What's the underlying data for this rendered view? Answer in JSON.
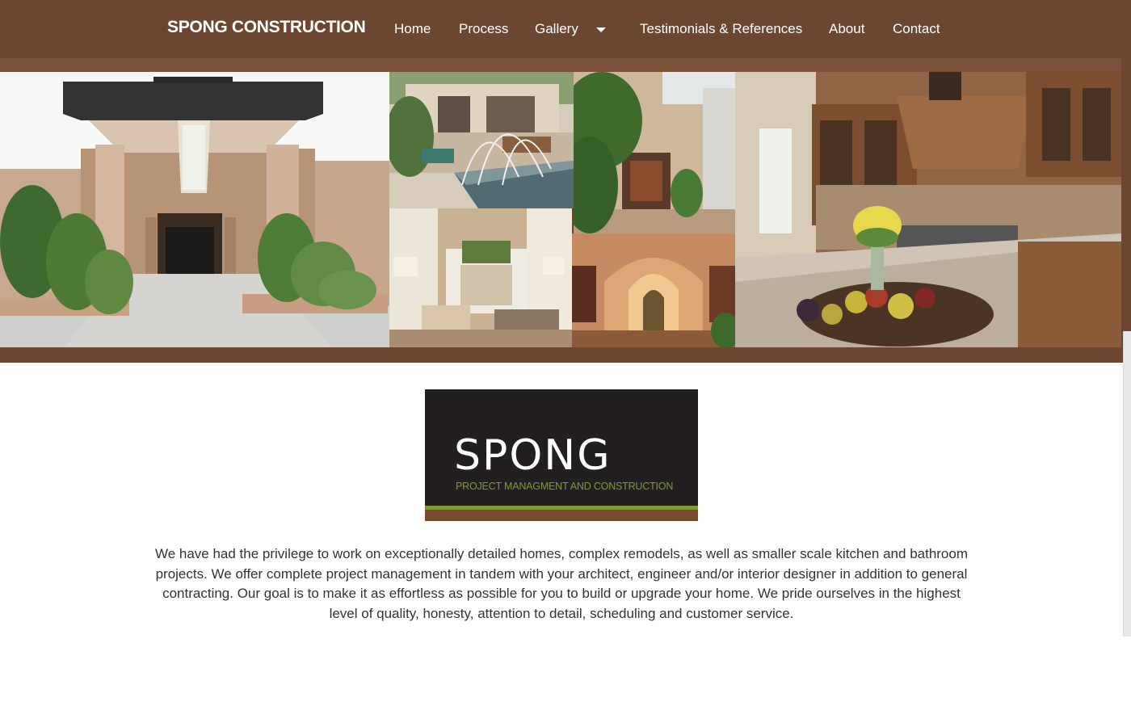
{
  "header": {
    "brand": "SPONG CONSTRUCTION",
    "nav": [
      {
        "label": "Home"
      },
      {
        "label": "Process"
      },
      {
        "label": "Gallery",
        "has_dropdown": true
      },
      {
        "label": "Testimonials & References"
      },
      {
        "label": "About"
      },
      {
        "label": "Contact"
      }
    ]
  },
  "hero": {
    "images": [
      "modern-entry-exterior-photo",
      "courtyard-fountain-pool-photo",
      "atrium-palms-photo",
      "living-room-photo",
      "arched-hallway-photo",
      "kitchen-fruit-bowl-photo"
    ]
  },
  "logo": {
    "word": "SPONG",
    "tagline": "PROJECT MANAGMENT AND CONSTRUCTION"
  },
  "intro": {
    "text": "We have had the privilege to work on exceptionally detailed homes, complex remodels, as well as smaller scale kitchen and bathroom projects. We offer complete project management in tandem with your architect, engineer and/or interior designer in addition to general contracting. Our goal is to make it as effortless as possible for you to build or upgrade your home. We pride ourselves in the highest level of quality, honesty, attention to detail, scheduling and customer service."
  },
  "colors": {
    "header_brown": "#6d4631",
    "logo_black": "#231f20",
    "logo_green": "#7f9a35",
    "logo_brown": "#7a4a2e",
    "text": "#333333"
  }
}
